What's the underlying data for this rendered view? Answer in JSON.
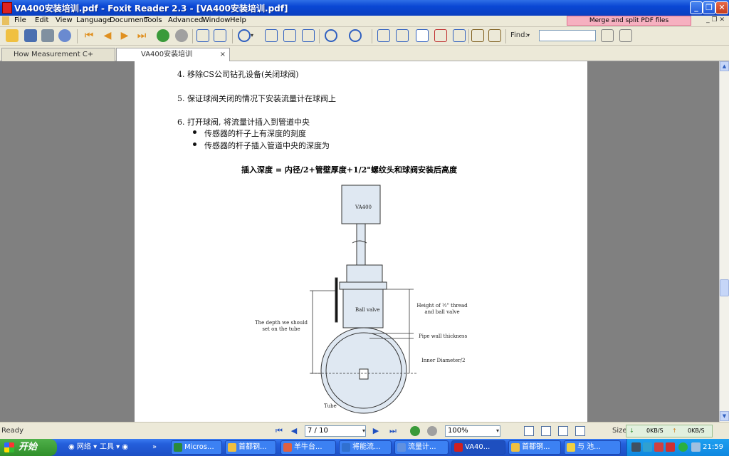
{
  "window": {
    "title": "VA400安装培训.pdf - Foxit Reader 2.3 - [VA400安装培训.pdf]"
  },
  "menu": [
    "File",
    "Edit",
    "View",
    "Language",
    "Document",
    "Tools",
    "Advanced",
    "Window",
    "Help"
  ],
  "promo": "Merge and split PDF files",
  "toolbar": {
    "find_label": "Find:",
    "find_value": ""
  },
  "tabs": [
    {
      "label": "How Measurement C+",
      "active": false
    },
    {
      "label": "VA400安装培训",
      "active": true
    }
  ],
  "document": {
    "steps": [
      "4. 移除CS公司钻孔设备(关闭球阀)",
      "5. 保证球阀关闭的情况下安装流量计在球阀上",
      "6. 打开球阀, 将流量计插入到管道中央"
    ],
    "bullets": [
      "传感器的杆子上有深度的刻度",
      "传感器的杆子插入管道中央的深度为"
    ],
    "formula": "插入深度 = 内径/2+管壁厚度+1/2\"螺纹头和球阀安装后高度",
    "diagram": {
      "sensor_label": "VA400",
      "valve_label": "Ball valve",
      "left_label": "The depth we should set on the tube",
      "right_labels": [
        "Height of ½\" thread and ball valve",
        "Pipe wall thickness",
        "Inner Diameter/2"
      ],
      "bottom_label": "Tube"
    }
  },
  "status": {
    "ready": "Ready",
    "page": "7 / 10",
    "zoom": "100%",
    "size_label": "Size",
    "down_rate": "0KB/S",
    "up_rate": "0KB/S"
  },
  "taskbar": {
    "start": "开始",
    "quicklaunch": [
      "网络",
      "工具"
    ],
    "tasks": [
      "Micros...",
      "首都钢...",
      "羊牛台...",
      "将能流...",
      "流量计...",
      "VA40...",
      "首都钢...",
      "与 池..."
    ],
    "clock": "21:59"
  }
}
